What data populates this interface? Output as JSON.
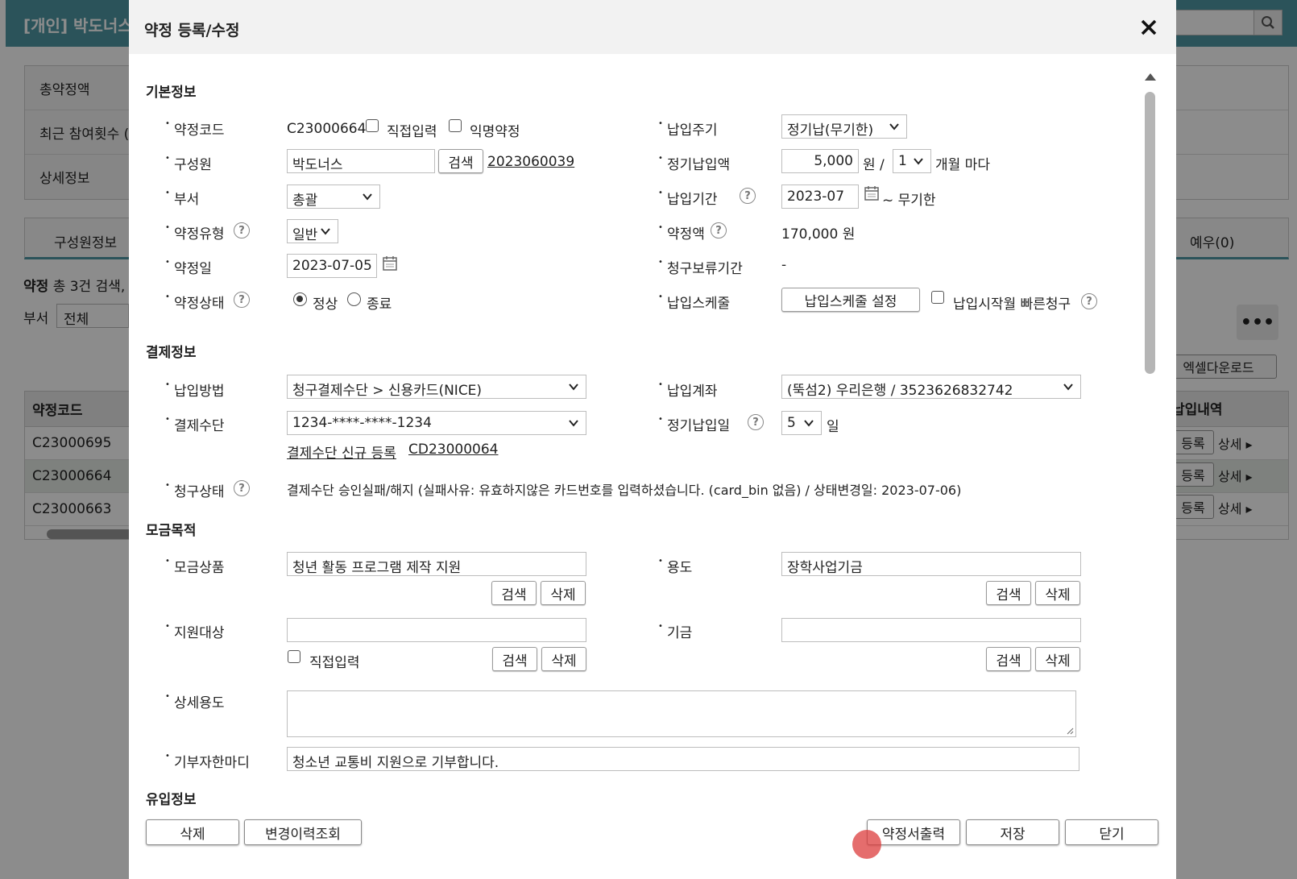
{
  "background": {
    "header_title": "[개인] 박도너스",
    "info_labels": [
      "총약정액",
      "최근 참여횟수 (",
      "상세정보"
    ],
    "tab_member": "구성원정보",
    "tab_reserve": "예우(0)",
    "count_prefix": "약정",
    "count_text": "총 3건 검색,",
    "dept_label": "부서",
    "dept_value": "전체",
    "more_label": "•••",
    "excel_button": "엑셀다운로드",
    "table_header": "약정코드",
    "table_header_right": "납입내역",
    "rows": [
      "C23000695",
      "C23000664",
      "C23000663"
    ],
    "register_label": "등록",
    "detail_label": "상세 ▸"
  },
  "modal": {
    "title": "약정 등록/수정",
    "sections": {
      "basic": "기본정보",
      "payment": "결제정보",
      "purpose": "모금목적",
      "inflow": "유입정보"
    },
    "basic": {
      "code_label": "약정코드",
      "code_value": "C23000664",
      "direct_input_label": "직접입력",
      "anonymous_label": "익명약정",
      "member_label": "구성원",
      "member_value": "박도너스",
      "search_label": "검색",
      "member_id": "2023060039",
      "dept_label": "부서",
      "dept_value": "총괄",
      "type_label": "약정유형",
      "type_value": "일반",
      "date_label": "약정일",
      "date_value": "2023-07-05",
      "status_label": "약정상태",
      "status_normal": "정상",
      "status_end": "종료",
      "cycle_label": "납입주기",
      "cycle_value": "정기납(무기한)",
      "amount_label": "정기납입액",
      "amount_value": "5,000",
      "amount_unit": "원 /",
      "month_value": "1",
      "month_unit": "개월 마다",
      "period_label": "납입기간",
      "period_value": "2023-07",
      "period_end": "~ 무기한",
      "total_label": "약정액",
      "total_value": "170,000 원",
      "hold_label": "청구보류기간",
      "hold_value": "-",
      "schedule_label": "납입스케줄",
      "schedule_button": "납입스케줄 설정",
      "fast_bill_label": "납입시작월 빠른청구"
    },
    "payment": {
      "method_label": "납입방법",
      "method_value": "청구결제수단 > 신용카드(NICE)",
      "account_label": "납입계좌",
      "account_value": "(뚝섬2) 우리은행 / 3523626832742",
      "means_label": "결제수단",
      "means_value": "1234-****-****-1234",
      "new_means_link": "결제수단 신규 등록",
      "means_code_link": "CD23000064",
      "day_label": "정기납입일",
      "day_value": "5",
      "day_unit": "일",
      "bill_status_label": "청구상태",
      "bill_status_value": "결제수단 승인실패/해지 (실패사유: 유효하지않은 카드번호를 입력하셨습니다. (card_bin 없음) / 상태변경일: 2023-07-06)"
    },
    "purpose": {
      "product_label": "모금상품",
      "product_value": "청년 활동 프로그램 제작 지원",
      "usage_label": "용도",
      "usage_value": "장학사업기금",
      "target_label": "지원대상",
      "target_value": "",
      "fund_label": "기금",
      "fund_value": "",
      "direct_input_label": "직접입력",
      "search_label": "검색",
      "delete_label": "삭제",
      "detail_usage_label": "상세용도",
      "detail_usage_value": "",
      "donor_msg_label": "기부자한마디",
      "donor_msg_value": "청소년 교통비 지원으로 기부합니다."
    },
    "footer": {
      "delete": "삭제",
      "history": "변경이력조회",
      "print": "약정서출력",
      "save": "저장",
      "close": "닫기"
    }
  }
}
